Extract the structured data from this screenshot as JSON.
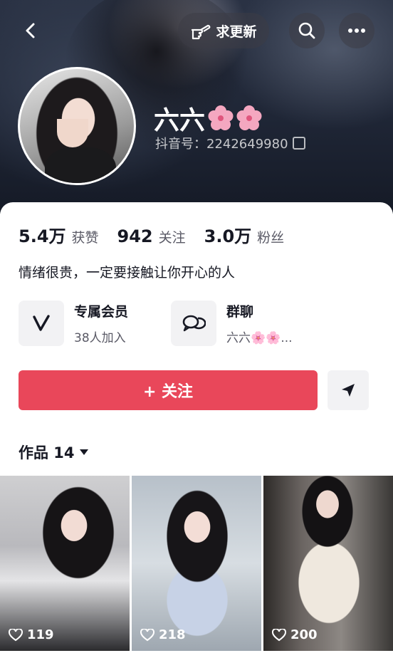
{
  "header": {
    "update_label": "求更新",
    "icons": [
      "back-icon",
      "finger-point-icon",
      "search-icon",
      "more-icon"
    ]
  },
  "profile": {
    "name": "六六",
    "id_label": "抖音号：2242649980"
  },
  "stats": [
    {
      "num": "5.4万",
      "label": "获赞"
    },
    {
      "num": "942",
      "label": "关注"
    },
    {
      "num": "3.0万",
      "label": "粉丝"
    }
  ],
  "bio": "情绪很贵，一定要接触让你开心的人",
  "features": {
    "member": {
      "title": "专属会员",
      "sub": "38人加入"
    },
    "group": {
      "title": "群聊",
      "sub": "六六🌸🌸..."
    }
  },
  "follow_label": "+ 关注",
  "works_label": "作品 14",
  "videos": [
    {
      "likes": "119"
    },
    {
      "likes": "218"
    },
    {
      "likes": "200"
    }
  ],
  "colors": {
    "accent": "#e9475a"
  }
}
